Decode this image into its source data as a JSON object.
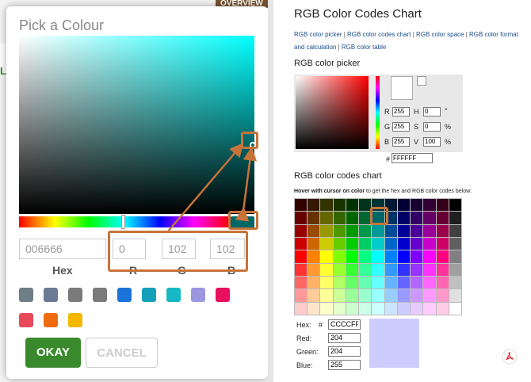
{
  "background": {
    "tab_label": "OVERVIEW",
    "side_text": "L"
  },
  "dialog": {
    "title": "Pick a Colour",
    "current_color": "#006666",
    "fields": {
      "hex": {
        "value": "006666",
        "label": "Hex"
      },
      "r": {
        "value": "0",
        "label": "R"
      },
      "g": {
        "value": "102",
        "label": "G"
      },
      "b": {
        "value": "102",
        "label": "B"
      }
    },
    "presets": [
      "#6e7e87",
      "#6a7a94",
      "#7a7a7a",
      "#7a7a7a",
      "#1a73d8",
      "#14a0b8",
      "#15b8c4",
      "#9a96e0",
      "#e8105c",
      "#e8485a",
      "#f06a10",
      "#f5b800"
    ],
    "okay_label": "OKAY",
    "cancel_label": "CANCEL"
  },
  "page": {
    "title": "RGB Color Codes Chart",
    "links": [
      "RGB color picker",
      "RGB color codes chart",
      "RGB color space",
      "RGB color format and calculation",
      "RGB color table"
    ],
    "picker_heading": "RGB color picker",
    "picker": {
      "r_label": "R",
      "r": "255",
      "h_label": "H",
      "h": "0",
      "h_unit": "°",
      "g_label": "G",
      "g": "255",
      "s_label": "S",
      "s": "0",
      "s_unit": "%",
      "b_label": "B",
      "b": "255",
      "v_label": "V",
      "v": "100",
      "v_unit": "%",
      "hash": "#",
      "hex": "FFFFFF"
    },
    "chart_heading": "RGB color codes chart",
    "hover_bold": "Hover with cursor on color",
    "hover_rest": " to get the hex and RGB color codes below:",
    "grid_rows": [
      [
        "#330000",
        "#331900",
        "#333300",
        "#193300",
        "#003300",
        "#003319",
        "#003333",
        "#001933",
        "#000033",
        "#190033",
        "#330033",
        "#330019",
        "#000000"
      ],
      [
        "#660000",
        "#663300",
        "#666600",
        "#336600",
        "#006600",
        "#006633",
        "#006666",
        "#003366",
        "#000066",
        "#330066",
        "#660066",
        "#660033",
        "#202020"
      ],
      [
        "#990000",
        "#994c00",
        "#999900",
        "#4c9900",
        "#009900",
        "#00994c",
        "#009999",
        "#004c99",
        "#000099",
        "#4c0099",
        "#990099",
        "#99004c",
        "#404040"
      ],
      [
        "#cc0000",
        "#cc6600",
        "#cccc00",
        "#66cc00",
        "#00cc00",
        "#00cc66",
        "#00cccc",
        "#0066cc",
        "#0000cc",
        "#6600cc",
        "#cc00cc",
        "#cc0066",
        "#606060"
      ],
      [
        "#ff0000",
        "#ff8000",
        "#ffff00",
        "#80ff00",
        "#00ff00",
        "#00ff80",
        "#00ffff",
        "#0080ff",
        "#0000ff",
        "#7f00ff",
        "#ff00ff",
        "#ff007f",
        "#808080"
      ],
      [
        "#ff3333",
        "#ff9933",
        "#ffff33",
        "#99ff33",
        "#33ff33",
        "#33ff99",
        "#33ffff",
        "#3399ff",
        "#3333ff",
        "#9933ff",
        "#ff33ff",
        "#ff3399",
        "#a0a0a0"
      ],
      [
        "#ff6666",
        "#ffb266",
        "#ffff66",
        "#b2ff66",
        "#66ff66",
        "#66ffb2",
        "#66ffff",
        "#66b2ff",
        "#6666ff",
        "#b266ff",
        "#ff66ff",
        "#ff66b2",
        "#c0c0c0"
      ],
      [
        "#ff9999",
        "#ffcc99",
        "#ffff99",
        "#ccff99",
        "#99ff99",
        "#99ffcc",
        "#99ffff",
        "#99ccff",
        "#9999ff",
        "#cc99ff",
        "#ff99ff",
        "#ff99cc",
        "#e0e0e0"
      ],
      [
        "#ffcccc",
        "#ffe5cc",
        "#ffffcc",
        "#e5ffcc",
        "#ccffcc",
        "#ccffe5",
        "#ccffff",
        "#cce5ff",
        "#ccccff",
        "#e5ccff",
        "#ffccff",
        "#ffcce5",
        "#ffffff"
      ]
    ],
    "output": {
      "hex_label": "Hex:",
      "hex_hash": "#",
      "hex": "CCCCFF",
      "red_label": "Red:",
      "red": "204",
      "green_label": "Green:",
      "green": "204",
      "blue_label": "Blue:",
      "blue": "255",
      "swatch_color": "#ccccff"
    }
  },
  "annotation": {
    "color": "#c8733a"
  }
}
